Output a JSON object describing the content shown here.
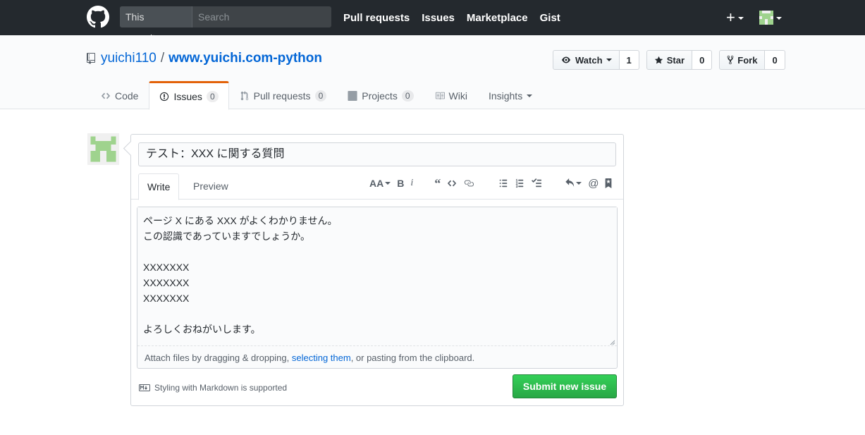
{
  "header": {
    "scope_label": "This repository",
    "search_placeholder": "Search",
    "nav": [
      "Pull requests",
      "Issues",
      "Marketplace",
      "Gist"
    ],
    "new_label": "+"
  },
  "repo": {
    "owner": "yuichi110",
    "separator": "/",
    "name": "www.yuichi.com-python",
    "watch_label": "Watch",
    "watch_count": "1",
    "star_label": "Star",
    "star_count": "0",
    "fork_label": "Fork",
    "fork_count": "0"
  },
  "reponav": {
    "code": "Code",
    "issues": "Issues",
    "issues_count": "0",
    "pulls": "Pull requests",
    "pulls_count": "0",
    "projects": "Projects",
    "projects_count": "0",
    "wiki": "Wiki",
    "insights": "Insights"
  },
  "issue_form": {
    "title_value": "テスト：XXX に関する質問",
    "tab_write": "Write",
    "tab_preview": "Preview",
    "body_value": "ページ X にある XXX がよくわかりません。\nこの認識であっていますでしょうか。\n\nXXXXXXX\nXXXXXXX\nXXXXXXX\n\nよろしくおねがいします。",
    "attach_prefix": "Attach files by dragging & dropping, ",
    "attach_link": "selecting them",
    "attach_suffix": ", or pasting from the clipboard.",
    "markdown_hint": "Styling with Markdown is supported",
    "submit_label": "Submit new issue"
  },
  "colors": {
    "header_bg": "#24292e",
    "link": "#0366d6",
    "submit_green": "#28a745",
    "selected_tab_accent": "#e36209",
    "avatar_green": "#9fd38e"
  }
}
